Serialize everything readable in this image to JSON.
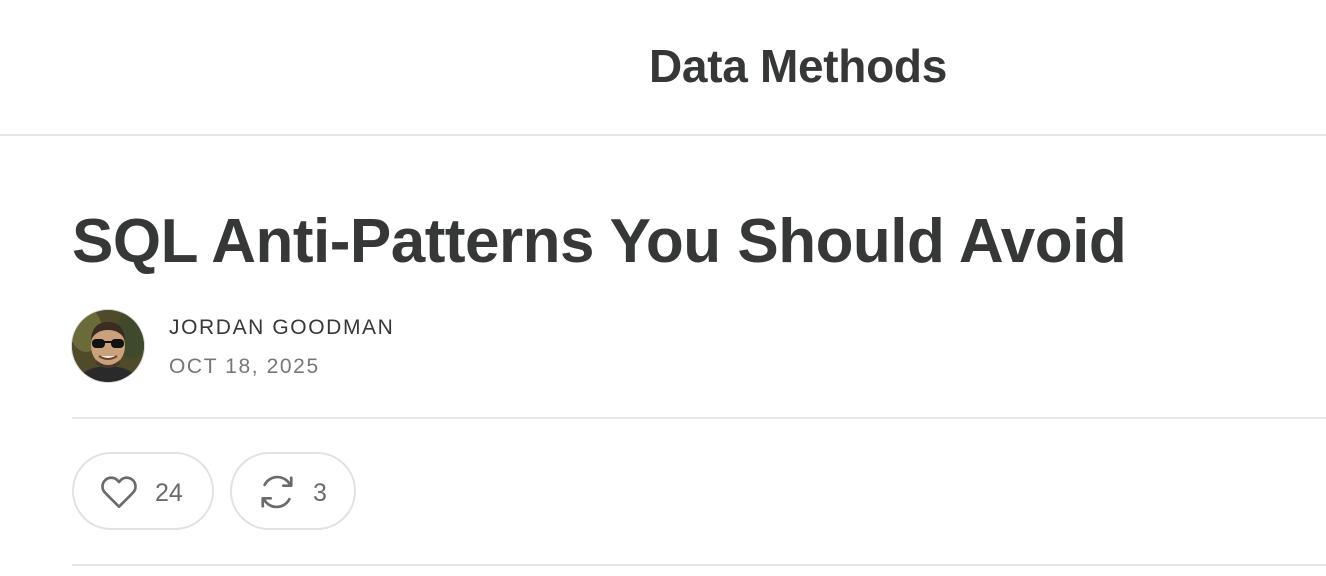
{
  "header": {
    "publication_name": "Data Methods"
  },
  "post": {
    "title": "SQL Anti-Patterns You Should Avoid",
    "author": "JORDAN GOODMAN",
    "date": "OCT 18, 2025"
  },
  "actions": {
    "like_count": "24",
    "restack_count": "3"
  },
  "icons": {
    "like": "heart-icon",
    "restack": "restack-icon"
  },
  "colors": {
    "text": "#363737",
    "muted": "#777777",
    "border": "#e6e6e6"
  }
}
